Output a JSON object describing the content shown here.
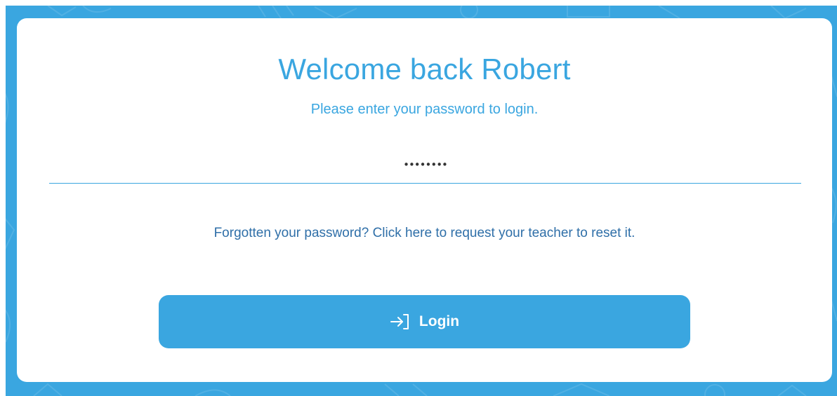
{
  "colors": {
    "accent": "#3aa6e0",
    "link": "#2f6fa8",
    "card": "#ffffff"
  },
  "login": {
    "title": "Welcome back Robert",
    "subtitle": "Please enter your password to login.",
    "password_value": "********",
    "forgot_link": "Forgotten your password? Click here to request your teacher to reset it.",
    "button_label": "Login",
    "button_icon": "login-arrow-icon"
  }
}
